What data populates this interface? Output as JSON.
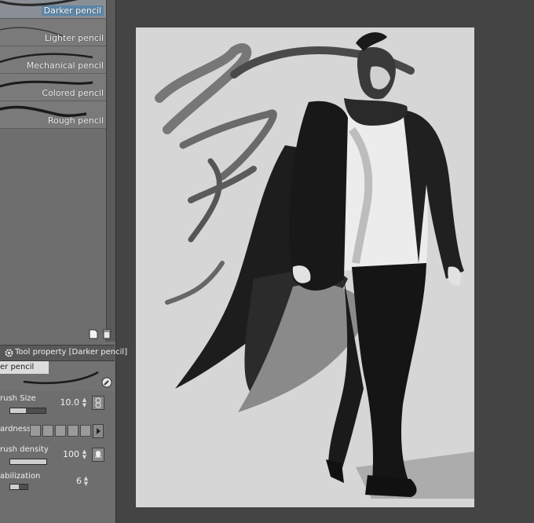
{
  "brush_list": {
    "items": [
      {
        "label": "Darker pencil",
        "selected": true
      },
      {
        "label": "Lighter pencil",
        "selected": false
      },
      {
        "label": "Mechanical pencil",
        "selected": false
      },
      {
        "label": "Colored pencil",
        "selected": false
      },
      {
        "label": "Rough pencil",
        "selected": false
      }
    ],
    "icons": {
      "new": "new-sub-tool-icon",
      "delete": "trash-icon"
    }
  },
  "tool_property": {
    "title": "Tool property [Darker pencil]",
    "header_icon": "gear-icon",
    "preview_tab": "er pencil",
    "settings_icon": "wrench-icon",
    "properties": [
      {
        "label": "rush Size",
        "value": "10.0",
        "level": 0.45,
        "icon": "brush-size-link-icon"
      },
      {
        "label": "ardness",
        "value": "",
        "level": 1.0,
        "icon": "play-icon"
      },
      {
        "label": "rush density",
        "value": "100",
        "level": 1.0,
        "icon": "pen-pressure-icon"
      },
      {
        "label": "abilization",
        "value": "6",
        "level": 0.5,
        "icon": ""
      }
    ]
  },
  "colors": {
    "panel": "#6e6e6e",
    "selected_highlight": "#5b86a8",
    "workspace": "#444444",
    "canvas": "#d6d6d6"
  }
}
